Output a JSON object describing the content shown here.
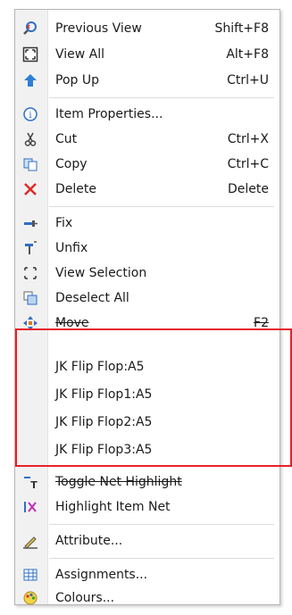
{
  "menu": {
    "group1": [
      {
        "label": "Previous View",
        "shortcut": "Shift+F8",
        "icon": "zoom-previous-icon"
      },
      {
        "label": "View All",
        "shortcut": "Alt+F8",
        "icon": "view-all-icon"
      },
      {
        "label": "Pop Up",
        "shortcut": "Ctrl+U",
        "icon": "pop-up-arrow-icon"
      }
    ],
    "group2": [
      {
        "label": "Item Properties...",
        "shortcut": "",
        "icon": "info-icon"
      },
      {
        "label": "Cut",
        "shortcut": "Ctrl+X",
        "icon": "scissors-icon"
      },
      {
        "label": "Copy",
        "shortcut": "Ctrl+C",
        "icon": "copy-icon"
      },
      {
        "label": "Delete",
        "shortcut": "Delete",
        "icon": "delete-x-icon"
      }
    ],
    "group3": [
      {
        "label": "Fix",
        "shortcut": "",
        "icon": "fix-pin-icon"
      },
      {
        "label": "Unfix",
        "shortcut": "",
        "icon": "unfix-pin-icon"
      },
      {
        "label": "View Selection",
        "shortcut": "",
        "icon": "view-selection-icon"
      },
      {
        "label": "Deselect All",
        "shortcut": "",
        "icon": "deselect-icon"
      },
      {
        "label": "Move",
        "shortcut": "F2",
        "icon": "move-icon"
      }
    ],
    "group4": [
      {
        "label": "JK Flip Flop:A5"
      },
      {
        "label": "JK Flip Flop1:A5"
      },
      {
        "label": "JK Flip Flop2:A5"
      },
      {
        "label": "JK Flip Flop3:A5"
      }
    ],
    "group5": [
      {
        "label": "Toggle Net Highlight",
        "shortcut": "",
        "icon": "toggle-net-icon"
      },
      {
        "label": "Highlight Item Net",
        "shortcut": "",
        "icon": "highlight-net-icon"
      }
    ],
    "group6": [
      {
        "label": "Attribute...",
        "shortcut": "",
        "icon": "attribute-icon"
      }
    ],
    "group7": [
      {
        "label": "Assignments...",
        "shortcut": "",
        "icon": "table-icon"
      },
      {
        "label": "Colours...",
        "shortcut": "",
        "icon": "palette-icon"
      }
    ]
  },
  "colors": {
    "highlight_box": "#e8202a",
    "accent_blue": "#2f6fc6"
  }
}
